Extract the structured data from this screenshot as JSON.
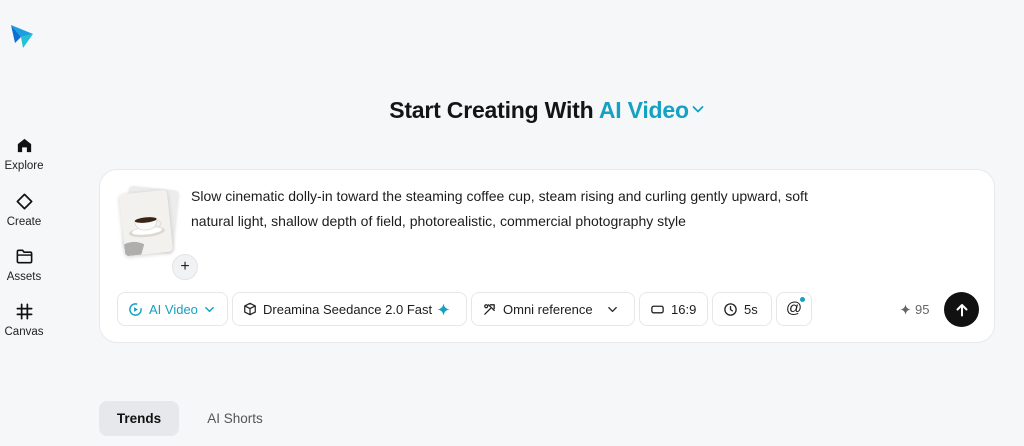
{
  "sidebar": {
    "items": [
      {
        "label": "Explore",
        "icon": "home-icon"
      },
      {
        "label": "Create",
        "icon": "diamond-icon"
      },
      {
        "label": "Assets",
        "icon": "folder-icon"
      },
      {
        "label": "Canvas",
        "icon": "canvas-icon"
      }
    ]
  },
  "header": {
    "title_prefix": "Start Creating With",
    "title_mode": "AI Video"
  },
  "prompt": {
    "text": "Slow cinematic dolly-in toward the steaming coffee cup, steam rising and curling gently upward, soft natural light, shallow depth of field, photorealistic, commercial photography style",
    "add_label": "+"
  },
  "toolbar": {
    "mode": "AI Video",
    "model": "Dreamina Seedance 2.0 Fast",
    "reference": "Omni reference",
    "ratio": "16:9",
    "duration": "5s",
    "mention": "@",
    "credits": "95"
  },
  "tabs": [
    {
      "label": "Trends",
      "active": true
    },
    {
      "label": "AI Shorts",
      "active": false
    }
  ],
  "colors": {
    "accent": "#14a1c4",
    "background": "#f6f7f9",
    "send_button": "#111111"
  }
}
